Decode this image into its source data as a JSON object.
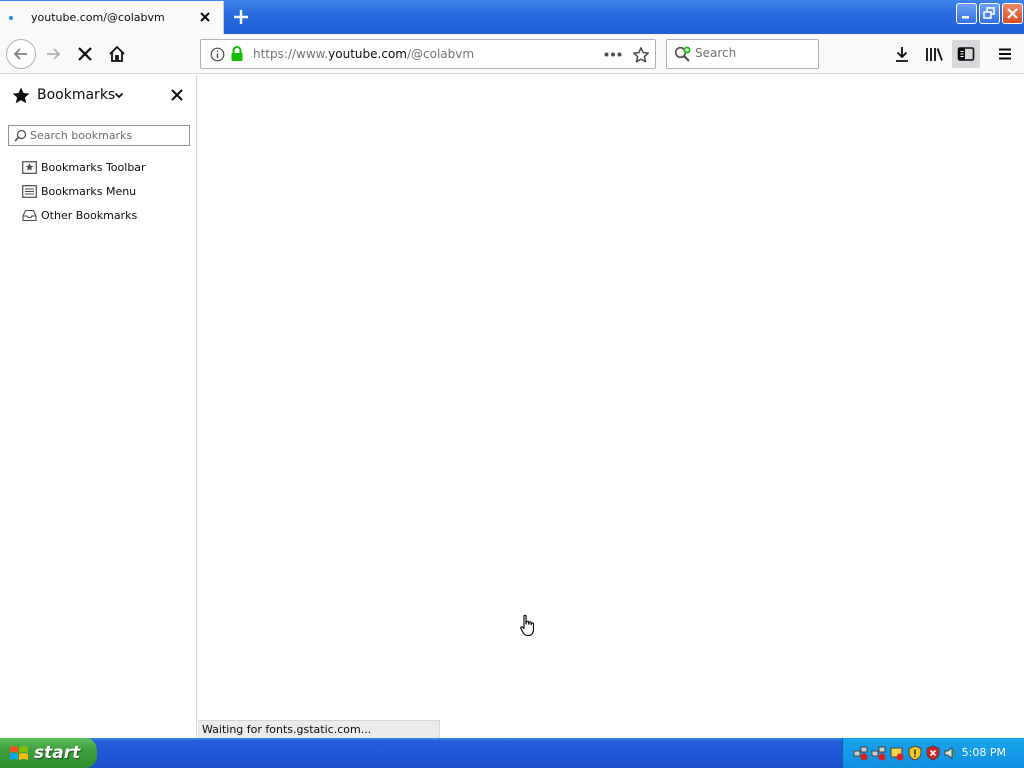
{
  "browser": {
    "tab": {
      "title": "youtube.com/@colabvm"
    },
    "url": {
      "prefix": "https://www.",
      "host": "youtube.com",
      "path": "/@colabvm"
    },
    "search": {
      "placeholder": "Search"
    }
  },
  "sidebar": {
    "title": "Bookmarks",
    "search_placeholder": "Search bookmarks",
    "items": [
      {
        "label": "Bookmarks Toolbar",
        "icon": "bookmarks-toolbar-icon"
      },
      {
        "label": "Bookmarks Menu",
        "icon": "bookmarks-menu-icon"
      },
      {
        "label": "Other Bookmarks",
        "icon": "other-bookmarks-icon"
      }
    ]
  },
  "status": {
    "text": "Waiting for fonts.gstatic.com..."
  },
  "taskbar": {
    "start_label": "start",
    "clock": "5:08 PM"
  },
  "colors": {
    "titlebar": "#2a6be0",
    "taskbar": "#245edb",
    "start": "#3c9f3c",
    "tray": "#0f8fe0",
    "lock": "#12bc00"
  }
}
